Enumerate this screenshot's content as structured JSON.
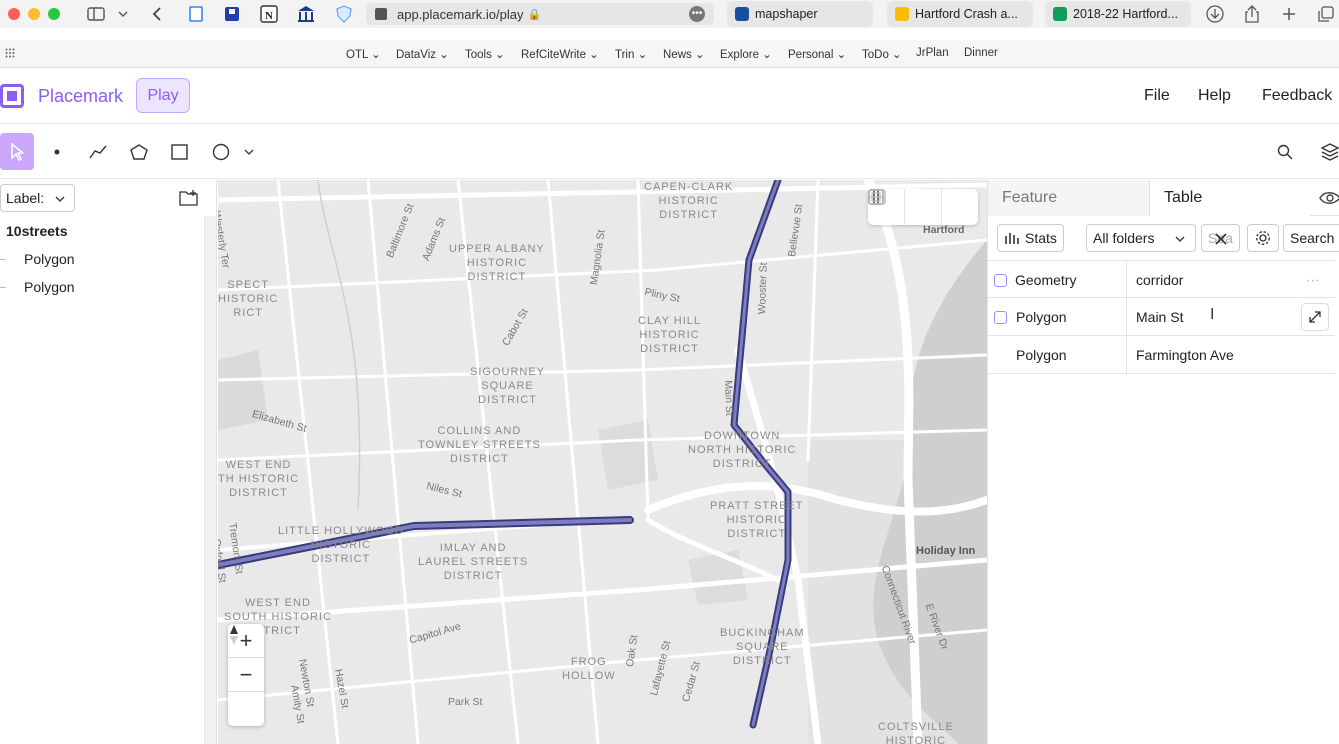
{
  "browser": {
    "url": "app.placemark.io/play",
    "tabs": [
      {
        "label": "mapshaper",
        "fav_color": "#1a4fa0"
      },
      {
        "label": "Hartford Crash a...",
        "fav_color": "#34a853"
      },
      {
        "label": "2018-22 Hartford...",
        "fav_color": "#0f9d58"
      }
    ],
    "bookmarks": [
      "OTL",
      "DataViz",
      "Tools",
      "RefCiteWrite",
      "Trin",
      "News",
      "Explore",
      "Personal",
      "ToDo",
      "JrPlan",
      "Dinner"
    ]
  },
  "app": {
    "brand": "Placemark",
    "mode": "Play",
    "menu": {
      "file": "File",
      "help": "Help",
      "feedback": "Feedback"
    },
    "accent": "#8b5cf6"
  },
  "sidebar": {
    "label_select": "Label:",
    "root": "10streets",
    "items": [
      {
        "label": "Polygon"
      },
      {
        "label": "Polygon"
      }
    ]
  },
  "map": {
    "districts": [
      "CAPEN-CLARK\nHISTORIC\nDISTRICT",
      "UPPER ALBANY\nHISTORIC\nDISTRICT",
      "SPECT\nHISTORIC\nRICT",
      "CLAY HILL\nHISTORIC\nDISTRICT",
      "SIGOURNEY\nSQUARE\nDISTRICT",
      "COLLINS AND\nTOWNLEY STREETS\nDISTRICT",
      "DOWNTOWN\nNORTH HISTORIC\nDISTRICT",
      "WEST END\nTH HISTORIC\nDISTRICT",
      "PRATT STREET\nHISTORIC\nDISTRICT",
      "LITTLE HOLLYWOOD\nHISTORIC\nDISTRICT",
      "IMLAY AND\nLAUREL STREETS\nDISTRICT",
      "WEST END\nSOUTH HISTORIC\nSTRICT",
      "BUCKINGHAM\nSQUARE\nDISTRICT",
      "FROG\nHOLLOW",
      "COLTSVILLE\nHISTORIC"
    ],
    "streets": [
      "Westerly Ter",
      "Baltimore St",
      "Adams St",
      "Magnolia St",
      "Pliny St",
      "Wooster St",
      "Bellevue St",
      "Cabot St",
      "Main St",
      "Elizabeth St",
      "Niles St",
      "Tremont St",
      "Oxford St",
      "Capitol Ave",
      "Newton St",
      "Hazel St",
      "Amity St",
      "Oak St",
      "Lafayette St",
      "Cedar St",
      "Park St",
      "Connecticut River",
      "E River Dr"
    ],
    "places": [
      "Hartford",
      "Holiday Inn"
    ]
  },
  "panel": {
    "tabs": {
      "feature": "Feature",
      "table": "Table"
    },
    "stats": "Stats",
    "folders": "All folders",
    "filter_placeholder": "Sea",
    "search": "Search",
    "columns": [
      "Geometry",
      "corridor"
    ],
    "rows": [
      {
        "geometry": "Polygon",
        "corridor": "Main St"
      },
      {
        "geometry": "Polygon",
        "corridor": "Farmington Ave"
      }
    ]
  }
}
